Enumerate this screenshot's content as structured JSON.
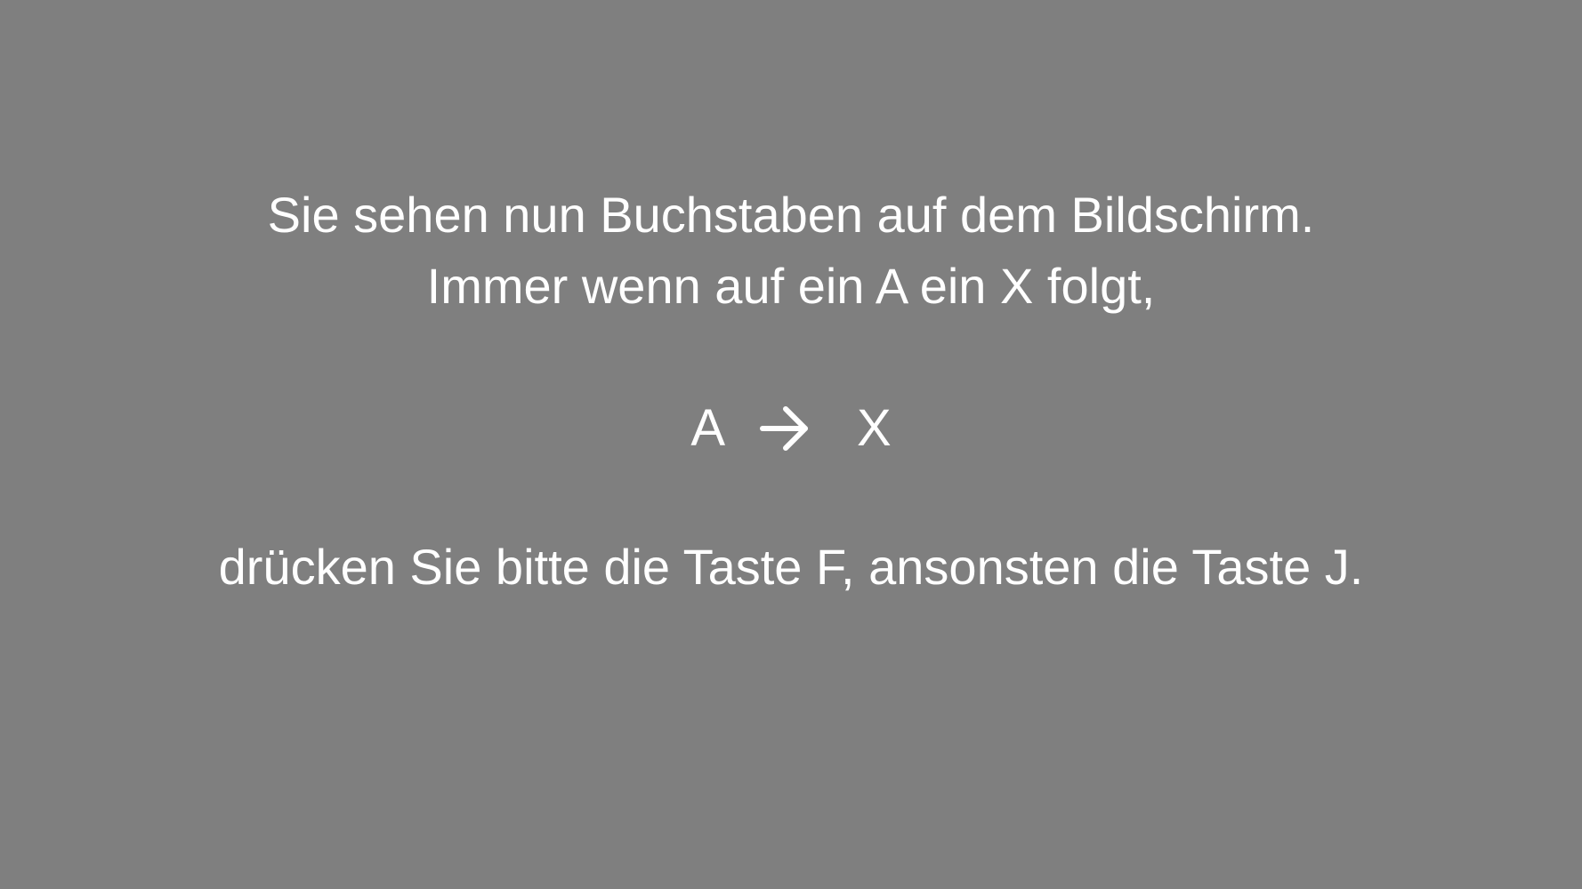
{
  "instructions": {
    "line1": "Sie sehen nun Buchstaben auf dem Bildschirm.",
    "line2": "Immer wenn auf ein A ein X folgt,",
    "line3": "drücken Sie bitte die Taste F, ansonsten die Taste J."
  },
  "sequence": {
    "first_letter": "A",
    "arrow_icon": "right-arrow-icon",
    "second_letter": "X"
  },
  "colors": {
    "background": "#7f7f7f",
    "text": "#ffffff"
  }
}
